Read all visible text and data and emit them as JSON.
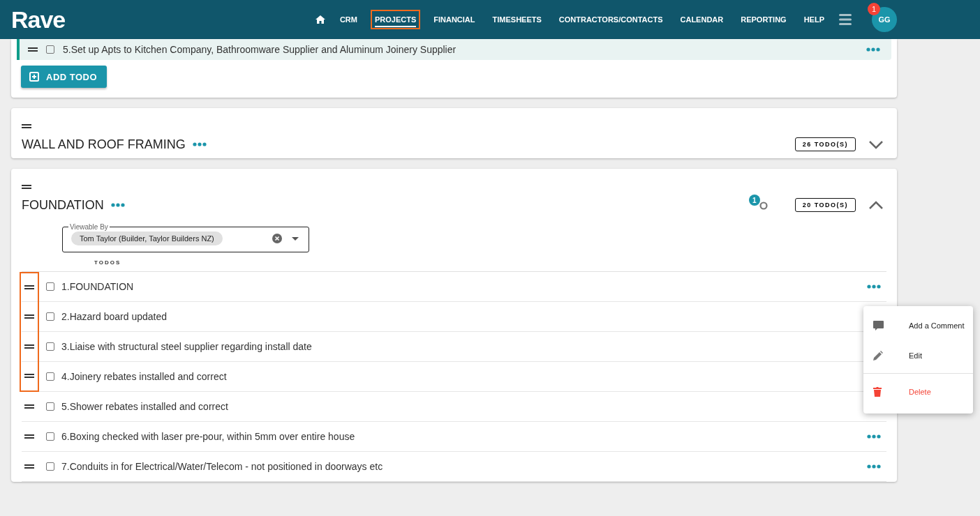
{
  "header": {
    "logo": "Rave",
    "nav": [
      {
        "label": "CRM",
        "selected": false,
        "highlighted": false
      },
      {
        "label": "PROJECTS",
        "selected": true,
        "highlighted": true
      },
      {
        "label": "FINANCIAL",
        "selected": false,
        "highlighted": false
      },
      {
        "label": "TIMESHEETS",
        "selected": false,
        "highlighted": false
      },
      {
        "label": "CONTRACTORS/CONTACTS",
        "selected": false,
        "highlighted": false
      },
      {
        "label": "CALENDAR",
        "selected": false,
        "highlighted": false
      },
      {
        "label": "REPORTING",
        "selected": false,
        "highlighted": false
      },
      {
        "label": "HELP",
        "selected": false,
        "highlighted": false
      }
    ],
    "avatar": {
      "initials": "GG",
      "badge": "1"
    }
  },
  "top_card": {
    "todo": {
      "text": "5.Set up Apts to Kitchen Company, Bathroomware Supplier and Aluminum Joinery Supplier",
      "checked": false,
      "selected": true
    },
    "add_button": "ADD TODO"
  },
  "sections": [
    {
      "title": "WALL AND ROOF FRAMING",
      "count": "26 TODO(S)",
      "expanded": false
    },
    {
      "title": "FOUNDATION",
      "count": "20 TODO(S)",
      "expanded": true,
      "watch_badge": "1",
      "viewable_by": {
        "label": "Viewable By",
        "chips": [
          "Tom Taylor (Builder, Taylor Builders NZ)"
        ]
      },
      "column_header": "TODOS",
      "todos": [
        {
          "text": "1.FOUNDATION",
          "checked": false,
          "highlighted": true
        },
        {
          "text": "2.Hazard board updated",
          "checked": false,
          "highlighted": true
        },
        {
          "text": "3.Liaise with structural steel supplier regarding install date",
          "checked": false,
          "highlighted": true
        },
        {
          "text": "4.Joinery rebates installed and correct",
          "checked": false,
          "highlighted": true
        },
        {
          "text": "5.Shower rebates installed and correct",
          "checked": false,
          "highlighted": false
        },
        {
          "text": "6.Boxing checked with laser pre-pour, within 5mm over entire house",
          "checked": false,
          "highlighted": false
        },
        {
          "text": "7.Conduits in for Electrical/Water/Telecom - not positioned in doorways etc",
          "checked": false,
          "highlighted": false
        }
      ]
    }
  ],
  "context_menu": [
    {
      "kind": "comment",
      "label": "Add a Comment"
    },
    {
      "kind": "edit",
      "label": "Edit"
    },
    {
      "kind": "delete",
      "label": "Delete"
    }
  ]
}
